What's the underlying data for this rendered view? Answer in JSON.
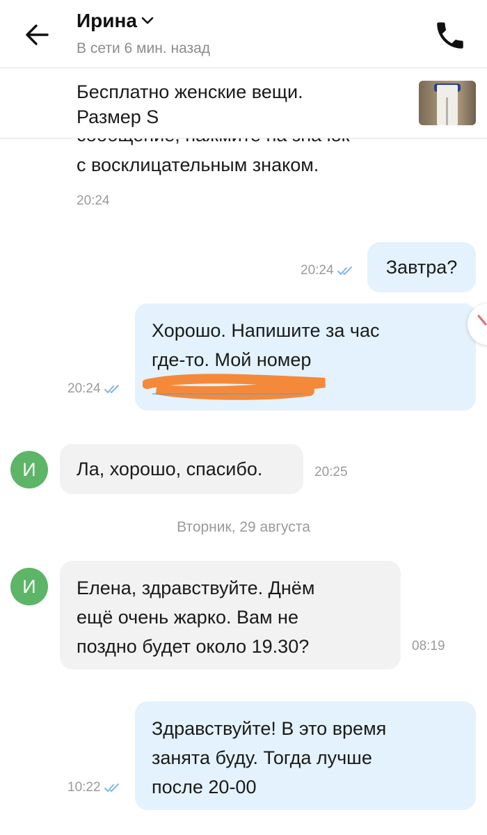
{
  "header": {
    "contact_name": "Ирина",
    "status": "В сети 6 мин. назад"
  },
  "ad": {
    "title": "Бесплатно женские вещи. Размер S"
  },
  "cut_message": {
    "line1": "сообщение, нажмите на значок",
    "line2": "с восклицательным знаком.",
    "time": "20:24"
  },
  "messages": [
    {
      "direction": "out",
      "text": "Завтра?",
      "time": "20:24",
      "read": true
    },
    {
      "direction": "out",
      "text_line1": "Хорошо. Напишите за час",
      "text_line2": "где-то. Мой номер",
      "time": "20:24",
      "read": true
    },
    {
      "direction": "in",
      "avatar_letter": "И",
      "text": "Ла, хорошо, спасибо.",
      "time": "20:25"
    },
    {
      "direction": "in",
      "avatar_letter": "И",
      "text_line1": "Елена, здравствуйте. Днём",
      "text_line2": "ещё очень жарко. Вам не",
      "text_line3": "поздно будет около 19.30?",
      "time": "08:19"
    },
    {
      "direction": "out",
      "text_line1": "Здравствуйте! В это время",
      "text_line2": "занята буду. Тогда лучше",
      "text_line3": "после 20-00",
      "time": "10:22",
      "read": true
    }
  ],
  "date_separator": "Вторник, 29 августа",
  "colors": {
    "outgoing_bubble": "#e3f2fd",
    "incoming_bubble": "#f2f2f2",
    "avatar": "#5db567",
    "read_ticks": "#7fb6e6",
    "redaction": "#f5893a"
  },
  "icons": {
    "back": "arrow-left-icon",
    "call": "phone-icon",
    "dropdown": "chevron-down-icon",
    "read_receipt": "double-check-icon"
  }
}
